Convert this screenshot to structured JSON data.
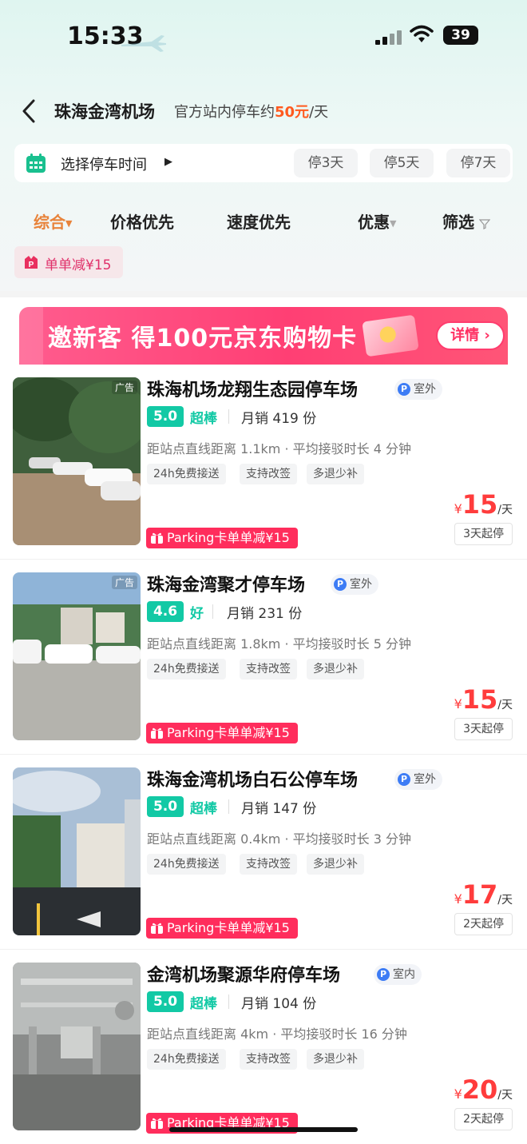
{
  "status": {
    "time": "15:33",
    "battery": "39"
  },
  "header": {
    "title": "珠海金湾机场",
    "sub_prefix": "官方站内停车约",
    "sub_price": "50元",
    "sub_suffix": "/天"
  },
  "time_bar": {
    "label": "选择停车时间",
    "options": [
      "停3天",
      "停5天",
      "停7天"
    ]
  },
  "sort": {
    "items": [
      "综合",
      "价格优先",
      "速度优先",
      "优惠",
      "筛选"
    ]
  },
  "discount_chip": "单单减¥15",
  "banner": {
    "text": "邀新客 得100元京东购物卡",
    "button": "详情"
  },
  "listings": [
    {
      "ad": "广告",
      "name": "珠海机场龙翔生态园停车场",
      "env": "室外",
      "rating": "5.0",
      "rating_word": "超棒",
      "sales": "月销 419 份",
      "distance": "距站点直线距离 1.1km · 平均接驳时长 4 分钟",
      "tags": [
        "24h免费接送",
        "支持改签",
        "多退少补"
      ],
      "promo": "Parking卡单单减¥15",
      "currency": "¥",
      "price": "15",
      "unit": "/天",
      "min_stay": "3天起停"
    },
    {
      "ad": "广告",
      "name": "珠海金湾聚才停车场",
      "env": "室外",
      "rating": "4.6",
      "rating_word": "好",
      "sales": "月销 231 份",
      "distance": "距站点直线距离 1.8km · 平均接驳时长 5 分钟",
      "tags": [
        "24h免费接送",
        "支持改签",
        "多退少补"
      ],
      "promo": "Parking卡单单减¥15",
      "currency": "¥",
      "price": "15",
      "unit": "/天",
      "min_stay": "3天起停"
    },
    {
      "ad": "",
      "name": "珠海金湾机场白石公停车场",
      "env": "室外",
      "rating": "5.0",
      "rating_word": "超棒",
      "sales": "月销 147 份",
      "distance": "距站点直线距离 0.4km · 平均接驳时长 3 分钟",
      "tags": [
        "24h免费接送",
        "支持改签",
        "多退少补"
      ],
      "promo": "Parking卡单单减¥15",
      "currency": "¥",
      "price": "17",
      "unit": "/天",
      "min_stay": "2天起停"
    },
    {
      "ad": "",
      "name": "金湾机场聚源华府停车场",
      "env": "室内",
      "rating": "5.0",
      "rating_word": "超棒",
      "sales": "月销 104 份",
      "distance": "距站点直线距离 4km · 平均接驳时长 16 分钟",
      "tags": [
        "24h免费接送",
        "支持改签",
        "多退少补"
      ],
      "promo": "Parking卡单单减¥15",
      "currency": "¥",
      "price": "20",
      "unit": "/天",
      "min_stay": "2天起停"
    }
  ]
}
